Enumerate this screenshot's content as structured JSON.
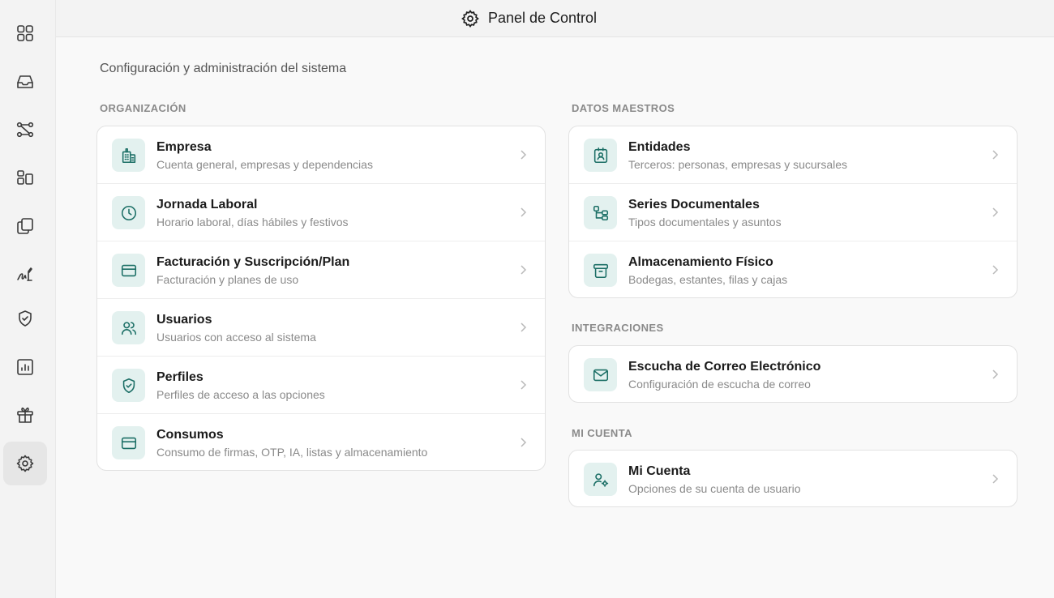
{
  "header": {
    "title": "Panel de Control",
    "icon": "gear-icon"
  },
  "subtitle": "Configuración y administración del sistema",
  "sidebar": {
    "items": [
      {
        "icon": "grid-icon"
      },
      {
        "icon": "inbox-icon"
      },
      {
        "icon": "workflow-icon"
      },
      {
        "icon": "layout-icon"
      },
      {
        "icon": "copy-icon"
      },
      {
        "icon": "signature-icon"
      },
      {
        "icon": "shield-check-icon"
      },
      {
        "icon": "report-chart-icon"
      },
      {
        "icon": "gift-icon"
      },
      {
        "icon": "settings-icon",
        "active": true
      }
    ]
  },
  "sections": {
    "organizacion": {
      "label": "ORGANIZACIÓN",
      "items": [
        {
          "name": "Empresa",
          "desc": "Cuenta general, empresas y dependencias",
          "icon": "building-icon"
        },
        {
          "name": "Jornada Laboral",
          "desc": "Horario laboral, días hábiles y festivos",
          "icon": "clock-icon"
        },
        {
          "name": "Facturación y Suscripción/Plan",
          "desc": "Facturación y planes de uso",
          "icon": "credit-card-icon"
        },
        {
          "name": "Usuarios",
          "desc": "Usuarios con acceso al sistema",
          "icon": "users-icon"
        },
        {
          "name": "Perfiles",
          "desc": "Perfiles de acceso a las opciones",
          "icon": "shield-check-icon"
        },
        {
          "name": "Consumos",
          "desc": "Consumo de firmas, OTP, IA, listas y almacenamiento",
          "icon": "credit-card-icon"
        }
      ]
    },
    "datos_maestros": {
      "label": "DATOS MAESTROS",
      "items": [
        {
          "name": "Entidades",
          "desc": "Terceros: personas, empresas y sucursales",
          "icon": "contact-card-icon"
        },
        {
          "name": "Series Documentales",
          "desc": "Tipos documentales y asuntos",
          "icon": "tree-icon"
        },
        {
          "name": "Almacenamiento Físico",
          "desc": "Bodegas, estantes, filas y cajas",
          "icon": "archive-box-icon"
        }
      ]
    },
    "integraciones": {
      "label": "INTEGRACIONES",
      "items": [
        {
          "name": "Escucha de Correo Electrónico",
          "desc": "Configuración de escucha de correo",
          "icon": "mail-icon"
        }
      ]
    },
    "mi_cuenta": {
      "label": "MI CUENTA",
      "items": [
        {
          "name": "Mi Cuenta",
          "desc": "Opciones de su cuenta de usuario",
          "icon": "user-settings-icon"
        }
      ]
    }
  },
  "colors": {
    "accent": "#1c6f66",
    "icon_bg": "#e3f1ef",
    "sidebar_bg": "#f3f3f3",
    "page_bg": "#f9f9f9"
  }
}
